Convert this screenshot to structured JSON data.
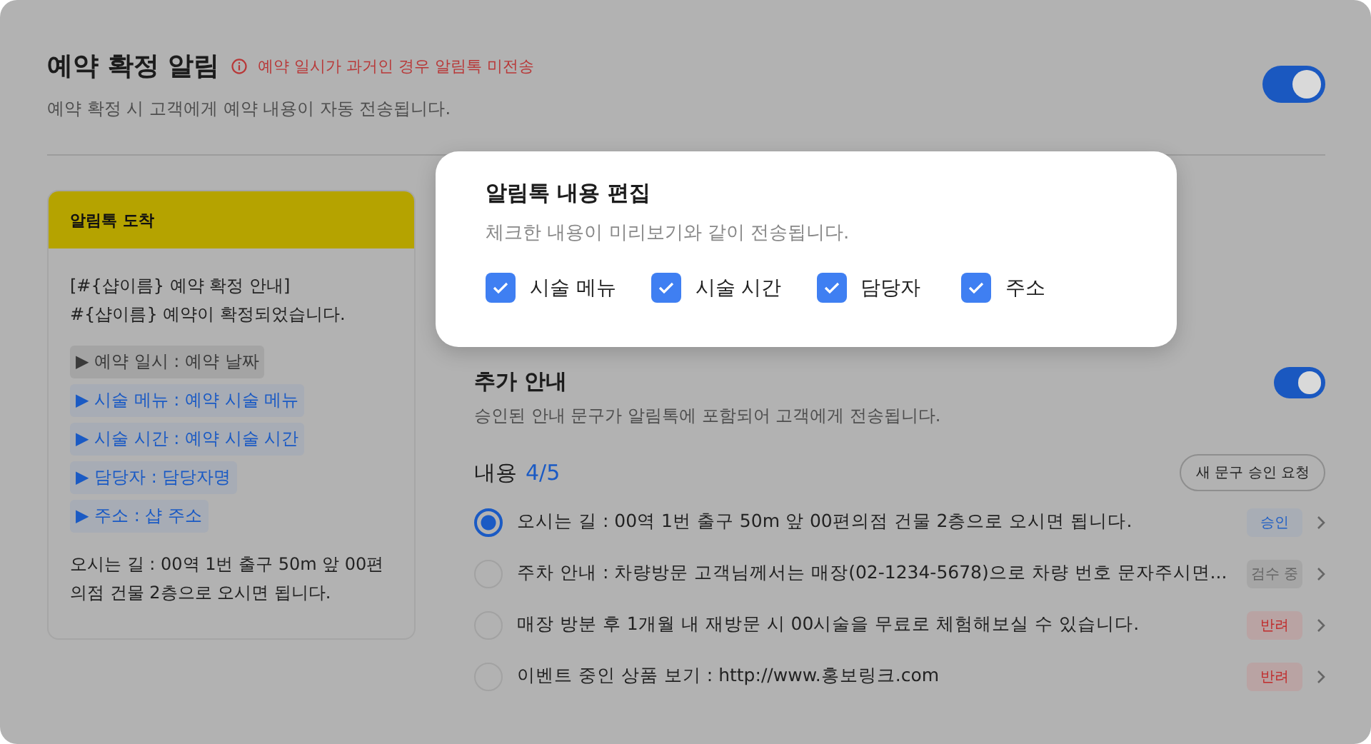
{
  "header": {
    "title": "예약 확정 알림",
    "warning": "예약 일시가 과거인 경우 알림톡 미전송",
    "description": "예약 확정 시 고객에게 예약 내용이 자동 전송됩니다.",
    "on": true
  },
  "preview": {
    "title": "알림톡 도착",
    "intro": [
      "[#{샵이름} 예약 확정 안내]",
      "#{샵이름} 예약이 확정되었습니다."
    ],
    "tags": [
      {
        "text": "▶ 예약 일시 : 예약 날짜",
        "highlighted": false
      },
      {
        "text": "▶ 시술 메뉴 : 예약 시술 메뉴",
        "highlighted": true
      },
      {
        "text": "▶ 시술 시간 : 예약 시술 시간",
        "highlighted": true
      },
      {
        "text": "▶ 담당자 : 담당자명",
        "highlighted": true
      },
      {
        "text": "▶ 주소 : 샵 주소",
        "highlighted": true
      }
    ],
    "footer": "오시는 길 : 00역 1번 출구 50m 앞 00편의점 건물 2층으로 오시면 됩니다."
  },
  "editor": {
    "title": "알림톡 내용 편집",
    "description": "체크한 내용이 미리보기와 같이 전송됩니다.",
    "options": [
      {
        "label": "시술 메뉴",
        "checked": true
      },
      {
        "label": "시술 시간",
        "checked": true
      },
      {
        "label": "담당자",
        "checked": true
      },
      {
        "label": "주소",
        "checked": true
      }
    ]
  },
  "extra": {
    "title": "추가 안내",
    "description": "승인된 안내 문구가 알림톡에 포함되어 고객에게 전송됩니다.",
    "on": true,
    "content_label": "내용",
    "count": "4/5",
    "request_button": "새 문구 승인 요청",
    "items": [
      {
        "text": "오시는 길 : 00역 1번 출구 50m 앞 00편의점 건물 2층으로 오시면 됩니다.",
        "selected": true,
        "status": "승인",
        "kind": "approved"
      },
      {
        "text": "주차 안내 : 차량방문 고객님께서는 매장(02-1234-5678)으로 차량 번호 문자주시면...",
        "selected": false,
        "status": "검수 중",
        "kind": "review"
      },
      {
        "text": "매장 방분 후 1개월 내 재방문 시 00시술을 무료로 체험해보실 수 있습니다.",
        "selected": false,
        "status": "반려",
        "kind": "rejected"
      },
      {
        "text": "이벤트 중인 상품 보기 : http://www.홍보링크.com",
        "selected": false,
        "status": "반려",
        "kind": "rejected"
      }
    ]
  }
}
